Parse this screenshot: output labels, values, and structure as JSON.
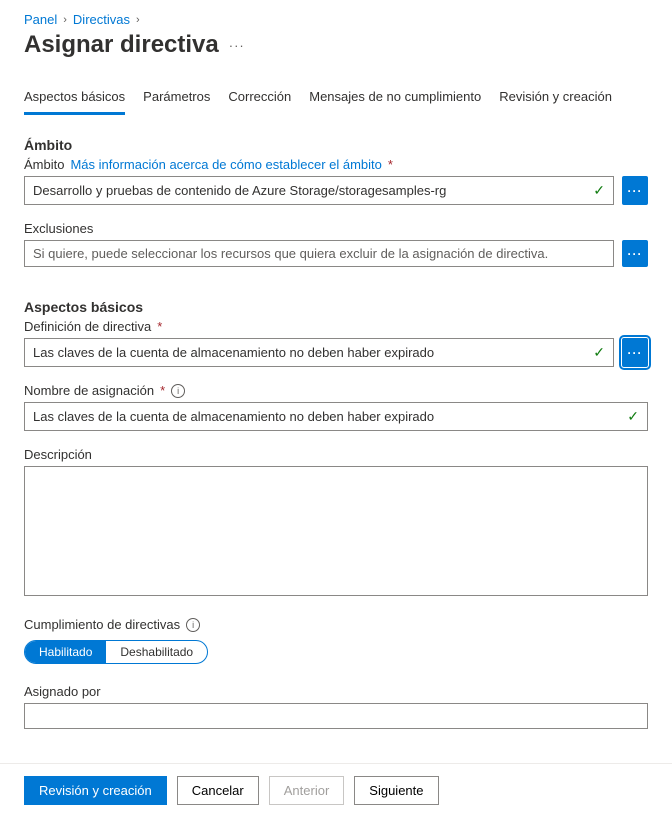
{
  "breadcrumb": {
    "panel": "Panel",
    "policies": "Directivas"
  },
  "title": "Asignar directiva",
  "tabs": {
    "basics": "Aspectos básicos",
    "parameters": "Parámetros",
    "remediation": "Corrección",
    "noncompliance": "Mensajes de no cumplimiento",
    "review": "Revisión y creación"
  },
  "scope": {
    "heading": "Ámbito",
    "label": "Ámbito",
    "link": "Más información acerca de cómo establecer el ámbito",
    "value": "Desarrollo y pruebas de contenido de Azure Storage/storagesamples-rg",
    "exclusions_label": "Exclusiones",
    "exclusions_placeholder": "Si quiere, puede seleccionar los recursos que quiera excluir de la asignación de directiva."
  },
  "basics": {
    "heading": "Aspectos básicos",
    "definition_label": "Definición de directiva",
    "definition_value": "Las claves de la cuenta de almacenamiento no deben haber expirado",
    "assignment_label": "Nombre de asignación",
    "assignment_value": "Las claves de la cuenta de almacenamiento no deben haber expirado",
    "description_label": "Descripción",
    "enforcement_label": "Cumplimiento de directivas",
    "enabled": "Habilitado",
    "disabled": "Deshabilitado",
    "assigned_by_label": "Asignado por",
    "assigned_by_value": ""
  },
  "footer": {
    "review": "Revisión y creación",
    "cancel": "Cancelar",
    "previous": "Anterior",
    "next": "Siguiente"
  },
  "icons": {
    "ellipsis": "···",
    "check": "✓",
    "info": "i",
    "chevron": "›"
  }
}
